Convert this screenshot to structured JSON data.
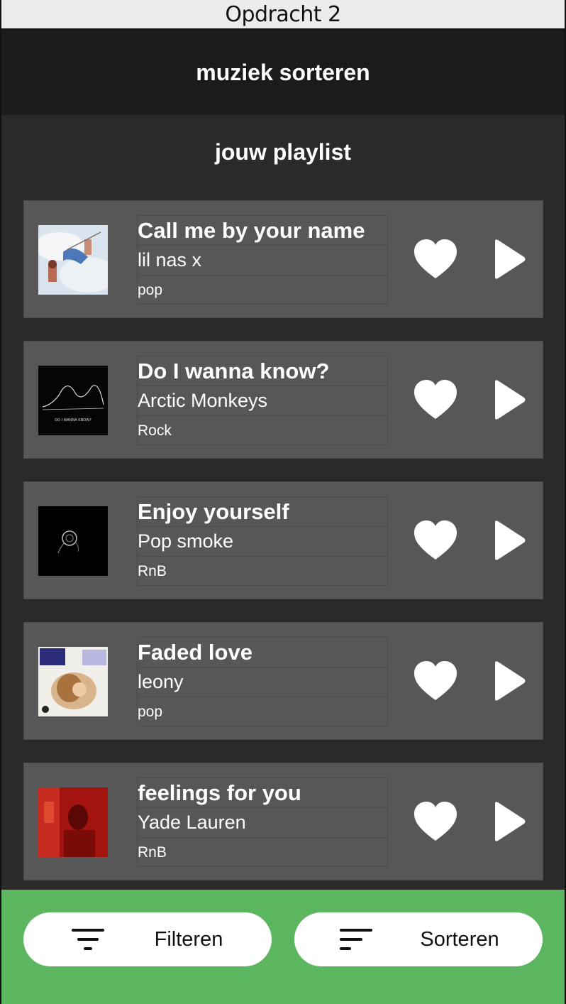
{
  "window": {
    "title": "Opdracht 2"
  },
  "header": {
    "title": "muziek sorteren"
  },
  "playlist": {
    "title": "jouw playlist",
    "songs": [
      {
        "title": "Call me by your name",
        "artist": "lil nas x",
        "genre": "pop",
        "cover": "album-cover-clouds"
      },
      {
        "title": "Do I wanna know?",
        "artist": "Arctic Monkeys",
        "genre": "Rock",
        "cover": "album-cover-black-wave"
      },
      {
        "title": "Enjoy yourself",
        "artist": "Pop smoke",
        "genre": "RnB",
        "cover": "album-cover-black-rose"
      },
      {
        "title": "Faded love",
        "artist": "leony",
        "genre": "pop",
        "cover": "album-cover-leony"
      },
      {
        "title": "feelings for you",
        "artist": "Yade Lauren",
        "genre": "RnB",
        "cover": "album-cover-red"
      }
    ]
  },
  "footer": {
    "filter_label": "Filteren",
    "sort_label": "Sorteren"
  },
  "colors": {
    "header_bg": "#1b1b1b",
    "page_bg": "#2a2a2a",
    "card_bg": "#575757",
    "footer_bg": "#5cb660"
  }
}
